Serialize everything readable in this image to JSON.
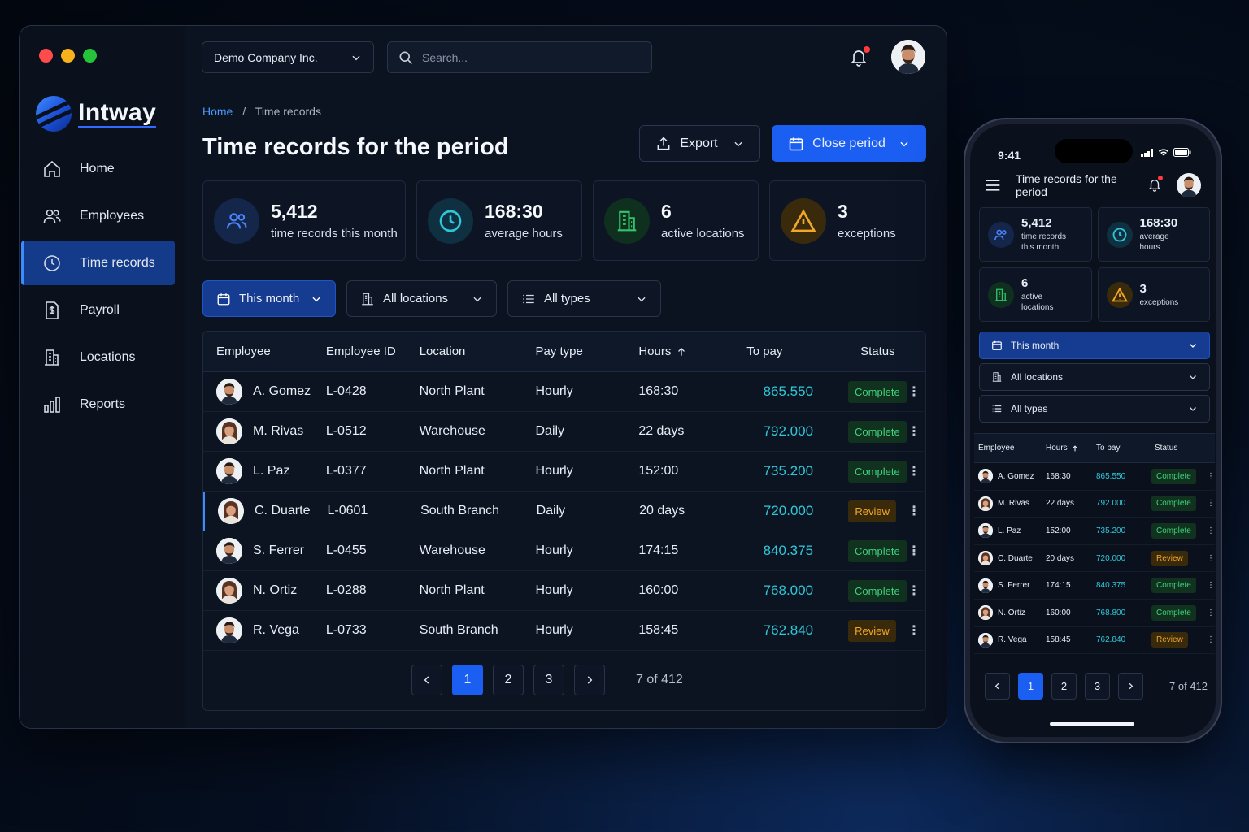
{
  "app": {
    "brand": "Intway",
    "company": "Demo Company Inc.",
    "search_placeholder": "Search..."
  },
  "sidebar": {
    "items": [
      {
        "label": "Home",
        "icon": "home-icon"
      },
      {
        "label": "Employees",
        "icon": "users-icon"
      },
      {
        "label": "Time records",
        "icon": "clock-icon",
        "active": true
      },
      {
        "label": "Payroll",
        "icon": "payroll-icon"
      },
      {
        "label": "Locations",
        "icon": "building-icon"
      },
      {
        "label": "Reports",
        "icon": "bar-chart-icon"
      }
    ]
  },
  "breadcrumb": {
    "home": "Home",
    "sep": "/",
    "current": "Time records"
  },
  "page": {
    "title": "Time records for the period",
    "export_label": "Export",
    "close_label": "Close period"
  },
  "stats": [
    {
      "value": "5,412",
      "label": "time records this month",
      "icon": "users-icon",
      "color": "#3b7bff"
    },
    {
      "value": "168:30",
      "label": "average hours",
      "icon": "clock-icon",
      "color": "#2fc7d8"
    },
    {
      "value": "6",
      "label": "active locations",
      "icon": "building-icon",
      "color": "#31c46a"
    },
    {
      "value": "3",
      "label": "exceptions",
      "icon": "warning-icon",
      "color": "#f3a728"
    }
  ],
  "filters": {
    "period": "This month",
    "location": "All locations",
    "type": "All types"
  },
  "table": {
    "headers": [
      "Employee",
      "Employee ID",
      "Location",
      "Pay type",
      "Hours",
      "To pay",
      "Status"
    ],
    "rows": [
      {
        "name": "A. Gomez",
        "id": "L-0428",
        "location": "North Plant",
        "pay_type": "Hourly",
        "hours": "168:30",
        "to_pay": "865.550",
        "status": "Complete"
      },
      {
        "name": "M. Rivas",
        "id": "L-0512",
        "location": "Warehouse",
        "pay_type": "Daily",
        "hours": "22 days",
        "to_pay": "792.000",
        "status": "Complete"
      },
      {
        "name": "L. Paz",
        "id": "L-0377",
        "location": "North Plant",
        "pay_type": "Hourly",
        "hours": "152:00",
        "to_pay": "735.200",
        "status": "Complete"
      },
      {
        "name": "C. Duarte",
        "id": "L-0601",
        "location": "South Branch",
        "pay_type": "Daily",
        "hours": "20 days",
        "to_pay": "720.000",
        "status": "Review"
      },
      {
        "name": "S. Ferrer",
        "id": "L-0455",
        "location": "Warehouse",
        "pay_type": "Hourly",
        "hours": "174:15",
        "to_pay": "840.375",
        "status": "Complete"
      },
      {
        "name": "N. Ortiz",
        "id": "L-0288",
        "location": "North Plant",
        "pay_type": "Hourly",
        "hours": "160:00",
        "to_pay": "768.000",
        "status": "Complete"
      },
      {
        "name": "R. Vega",
        "id": "L-0733",
        "location": "South Branch",
        "pay_type": "Hourly",
        "hours": "158:45",
        "to_pay": "762.840",
        "status": "Review"
      }
    ]
  },
  "pagination": {
    "pages": [
      "1",
      "2",
      "3"
    ],
    "current": "1",
    "info": "7 of 412"
  },
  "phone": {
    "time": "9:41",
    "title": "Time records for the period",
    "stats": [
      {
        "value": "5,412",
        "label": "time records this month"
      },
      {
        "value": "168:30",
        "label": "average hours"
      },
      {
        "value": "6",
        "label": "active locations"
      },
      {
        "value": "3",
        "label": "exceptions"
      }
    ],
    "headers": [
      "Employee",
      "Hours",
      "To pay",
      "Status"
    ],
    "rows": [
      {
        "name": "A. Gomez",
        "hours": "168:30",
        "to_pay": "865.550",
        "status": "Complete"
      },
      {
        "name": "M. Rivas",
        "hours": "22 days",
        "to_pay": "792.000",
        "status": "Complete"
      },
      {
        "name": "L. Paz",
        "hours": "152:00",
        "to_pay": "735.200",
        "status": "Complete"
      },
      {
        "name": "C. Duarte",
        "hours": "20 days",
        "to_pay": "720.000",
        "status": "Review"
      },
      {
        "name": "S. Ferrer",
        "hours": "174:15",
        "to_pay": "840.375",
        "status": "Complete"
      },
      {
        "name": "N. Ortiz",
        "hours": "160:00",
        "to_pay": "768.800",
        "status": "Complete"
      },
      {
        "name": "R. Vega",
        "hours": "158:45",
        "to_pay": "762.840",
        "status": "Review"
      }
    ]
  },
  "colors": {
    "accent": "#1b5ef2",
    "money": "#2fc7d8",
    "complete": "#3ed27a",
    "review": "#f3a728"
  }
}
